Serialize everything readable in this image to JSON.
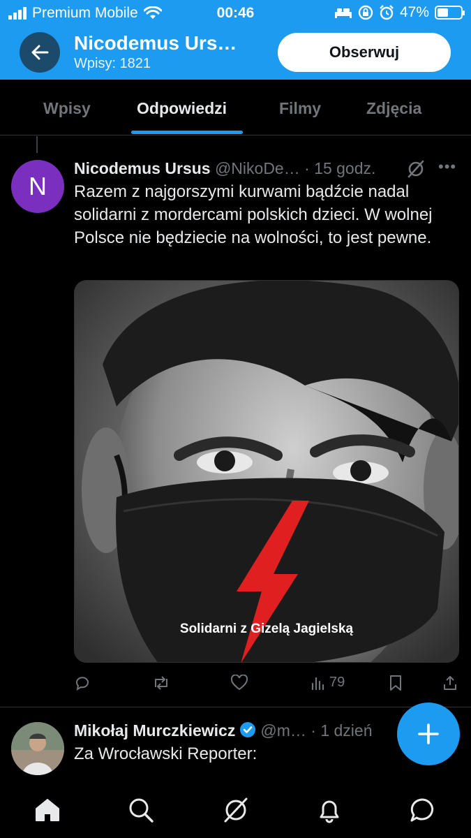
{
  "status_bar": {
    "carrier": "Premium Mobile",
    "time": "00:46",
    "battery_percent": "47%",
    "battery_level": 0.47,
    "icons": [
      "signal-icon",
      "wifi-icon",
      "bed-icon",
      "orientation-lock-icon",
      "alarm-icon",
      "battery-icon"
    ]
  },
  "header": {
    "back_icon": "arrow-left-icon",
    "profile_name": "Nicodemus Urs…",
    "posts_count": "Wpisy: 1821",
    "follow_label": "Obserwuj"
  },
  "tabs": [
    {
      "label": "Wpisy",
      "active": false
    },
    {
      "label": "Odpowiedzi",
      "active": true
    },
    {
      "label": "Filmy",
      "active": false
    },
    {
      "label": "Zdjęcia",
      "active": false
    }
  ],
  "tweets": [
    {
      "avatar_letter": "N",
      "avatar_color": "#7b2fbe",
      "name": "Nicodemus Ursus",
      "handle": "@NikoDe…",
      "time": "· 15 godz.",
      "text": "Razem z najgorszymi kurwami bądźcie nadal solidarni z mordercami polskich dzieci. W wolnej Polsce nie będziecie na wolności, to jest pewne.",
      "media_caption": "Solidarni z Gizelą Jagielską",
      "views": "79"
    },
    {
      "name": "Mikołaj Murczkiewicz",
      "handle": "@m…",
      "time": "· 1 dzień",
      "text": "Za Wrocławski Reporter:",
      "verified": true
    }
  ],
  "colors": {
    "accent": "#1d9bf0",
    "background": "#000000",
    "muted": "#71767b",
    "lightning": "#e02020"
  },
  "bottom_nav": [
    "home-icon",
    "search-icon",
    "grok-icon",
    "notifications-icon",
    "messages-icon"
  ],
  "fab_icon": "plus-icon"
}
